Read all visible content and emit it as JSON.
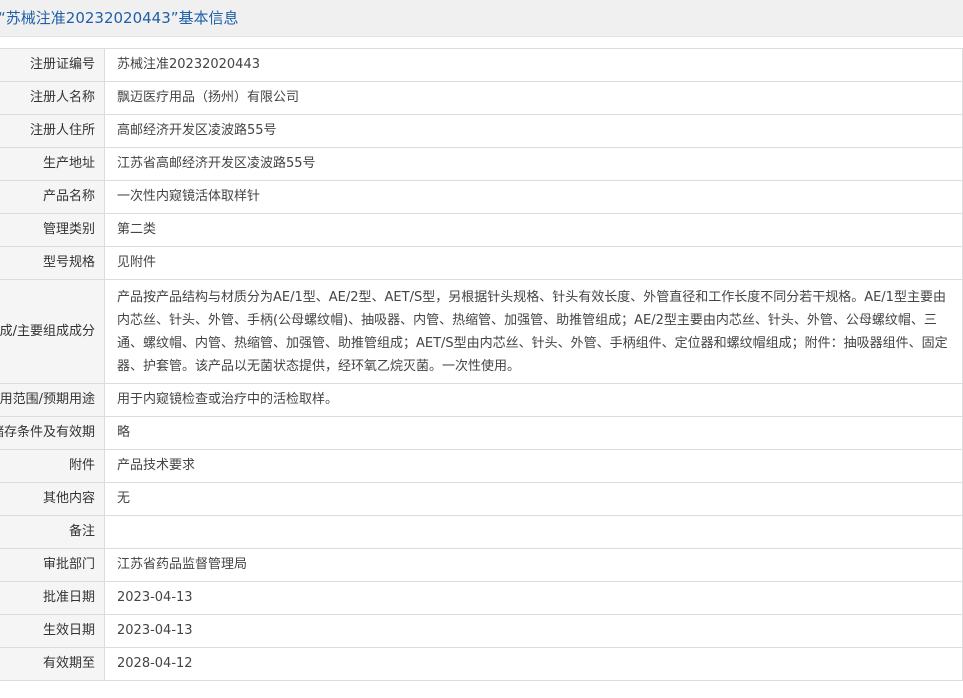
{
  "header": {
    "title": "“苏械注准20232020443”基本信息"
  },
  "rows": [
    {
      "label": "注册证编号",
      "value": "苏械注准20232020443"
    },
    {
      "label": "注册人名称",
      "value": "飘迈医疗用品（扬州）有限公司"
    },
    {
      "label": "注册人住所",
      "value": "高邮经济开发区凌波路55号"
    },
    {
      "label": "生产地址",
      "value": "江苏省高邮经济开发区凌波路55号"
    },
    {
      "label": "产品名称",
      "value": "一次性内窥镜活体取样针"
    },
    {
      "label": "管理类别",
      "value": "第二类"
    },
    {
      "label": "型号规格",
      "value": "见附件"
    },
    {
      "label": "结构及组成/主要组成成分",
      "value": "产品按产品结构与材质分为AE/1型、AE/2型、AET/S型，另根据针头规格、针头有效长度、外管直径和工作长度不同分若干规格。AE/1型主要由内芯丝、针头、外管、手柄(公母螺纹帽)、抽吸器、内管、热缩管、加强管、助推管组成；AE/2型主要由内芯丝、针头、外管、公母螺纹帽、三通、螺纹帽、内管、热缩管、加强管、助推管组成；AET/S型由内芯丝、针头、外管、手柄组件、定位器和螺纹帽组成；附件：抽吸器组件、固定器、护套管。该产品以无菌状态提供，经环氧乙烷灭菌。一次性使用。"
    },
    {
      "label": "适用范围/预期用途",
      "value": "用于内窥镜检查或治疗中的活检取样。"
    },
    {
      "label": "产品储存条件及有效期",
      "value": "略"
    },
    {
      "label": "附件",
      "value": "产品技术要求"
    },
    {
      "label": "其他内容",
      "value": "无"
    },
    {
      "label": "备注",
      "value": ""
    },
    {
      "label": "审批部门",
      "value": "江苏省药品监督管理局"
    },
    {
      "label": "批准日期",
      "value": "2023-04-13"
    },
    {
      "label": "生效日期",
      "value": "2023-04-13"
    },
    {
      "label": "有效期至",
      "value": "2028-04-12"
    }
  ]
}
